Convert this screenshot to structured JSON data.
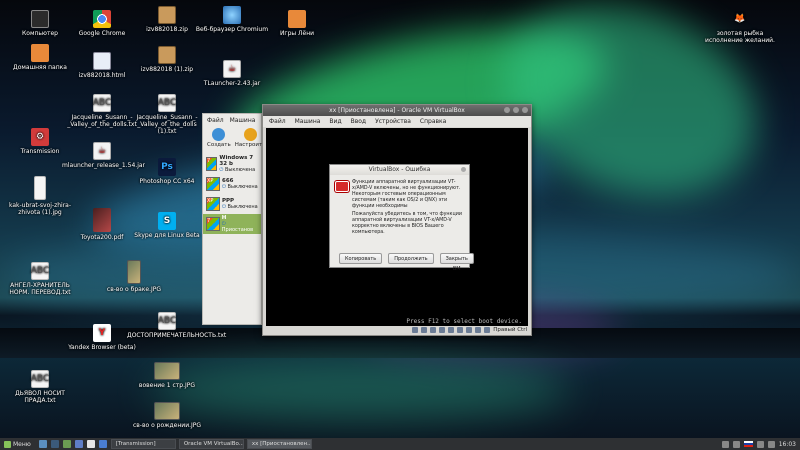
{
  "desktop_icons": [
    {
      "id": "komputer",
      "label": "Компьютер",
      "icon": "monitor-icon"
    },
    {
      "id": "home",
      "label": "Домашняя папка",
      "icon": "folder-icon"
    },
    {
      "id": "transmission",
      "label": "Transmission",
      "icon": "transmission-icon"
    },
    {
      "id": "chrome",
      "label": "Google Chrome",
      "icon": "chrome-icon"
    },
    {
      "id": "izv_html",
      "label": "izv882018.html",
      "icon": "html-file-icon"
    },
    {
      "id": "susann1",
      "label": "Jacqueline_Susann_-_Valley_of_the_dolls.txt",
      "icon": "text-file-icon"
    },
    {
      "id": "mlauncher",
      "label": "mlauncher_release_1.54.jar",
      "icon": "java-file-icon"
    },
    {
      "id": "zip1",
      "label": "izv882018.zip",
      "icon": "archive-icon"
    },
    {
      "id": "zip2",
      "label": "izv882018 (1).zip",
      "icon": "archive-icon"
    },
    {
      "id": "susann2",
      "label": "Jacqueline_Susann_-_Valley_of_the_dolls (1).txt",
      "icon": "text-file-icon"
    },
    {
      "id": "photoshop",
      "label": "Photoshop CC x64",
      "icon": "photoshop-icon"
    },
    {
      "id": "chromium",
      "label": "Веб-браузер Chromium",
      "icon": "globe-icon"
    },
    {
      "id": "tlauncher",
      "label": "TLauncher-2.43.jar",
      "icon": "java-file-icon"
    },
    {
      "id": "games",
      "label": "Игры Лёни",
      "icon": "folder-icon"
    },
    {
      "id": "zhira",
      "label": "kak-ubrat-svoj-zhira-zhivota (1).jpg",
      "icon": "image-file-icon"
    },
    {
      "id": "toyota",
      "label": "Toyota200.pdf",
      "icon": "pdf-file-icon"
    },
    {
      "id": "skype",
      "label": "Skype для Linux Beta",
      "icon": "skype-icon"
    },
    {
      "id": "angel",
      "label": "АНГЕЛ-ХРАНИТЕЛЬ НОРМ. ПЕРЕВОД.txt",
      "icon": "text-file-icon"
    },
    {
      "id": "brak",
      "label": "св-во о браке.JPG",
      "icon": "image-file-icon"
    },
    {
      "id": "yandex",
      "label": "Yandex Browser (beta)",
      "icon": "yandex-icon"
    },
    {
      "id": "dostop",
      "label": "ДОСТОПРИМЕЧАТЕЛЬНОСТЬ.txt",
      "icon": "text-file-icon"
    },
    {
      "id": "venie",
      "label": "вовение 1 стр.JPG",
      "icon": "image-file-icon"
    },
    {
      "id": "dyavol",
      "label": "ДЬЯВОЛ НОСИТ ПРАДА.txt",
      "icon": "text-file-icon"
    },
    {
      "id": "rozhd",
      "label": "св-во о рождении.JPG",
      "icon": "image-file-icon"
    },
    {
      "id": "rybka",
      "label": "золотая рыбка исполнение желаний.",
      "icon": "fox-icon"
    }
  ],
  "vbox_manager": {
    "menu": [
      "Файл",
      "Машина"
    ],
    "tools": [
      {
        "label": "Создать"
      },
      {
        "label": "Настроить"
      }
    ],
    "vms": [
      {
        "name": "Windows 7 32 b",
        "state": "Выключена",
        "os": "7"
      },
      {
        "name": "666",
        "state": "Выключена",
        "os": "XP"
      },
      {
        "name": "PPP",
        "state": "Выключена",
        "os": "XP"
      },
      {
        "name": "Н",
        "state": "Приостанов",
        "os": "7"
      }
    ]
  },
  "vm_window": {
    "title": "xx [Приостановлена] - Oracle VM VirtualBox",
    "menu": [
      "Файл",
      "Машина",
      "Вид",
      "Ввод",
      "Устройства",
      "Справка"
    ],
    "boot_message": "Press F12 to select boot device.",
    "host_key": "Правый Ctrl"
  },
  "dialog": {
    "title": "VirtualBox - Ошибка",
    "message1": "Функции аппаратной виртуализации VT-x/AMD-V включены, но не функционируют. Некоторым гостевым операционным системам (таким как OS/2 и QNX) эти функции необходимы",
    "message2": "Пожалуйста убедитесь в том, что функции аппаратной виртуализации VT-x/AMD-V корректно включены в BIOS Вашего компьютера.",
    "buttons": {
      "copy": "Копировать",
      "continue": "Продолжить",
      "close": "Закрыть ВМ"
    }
  },
  "taskbar": {
    "menu_label": "Меню",
    "tasks": [
      {
        "label": "[Transmission]"
      },
      {
        "label": "Oracle VM VirtualBo..."
      },
      {
        "label": "xx [Приостановлен..."
      }
    ],
    "clock": "16:03"
  },
  "colors": {
    "taskbar": "#2e3033",
    "vm_selected": "#8fb35a",
    "error_red": "#d52a2a"
  }
}
